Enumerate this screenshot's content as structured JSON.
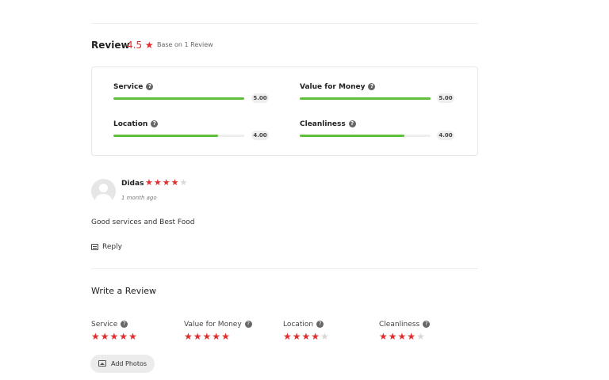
{
  "summary": {
    "title": "Review",
    "rating": "4.5",
    "star_glyph": "★",
    "based_on": "Base on 1 Review"
  },
  "categories": [
    {
      "label": "Service",
      "score": "5.00",
      "fill": 1.0
    },
    {
      "label": "Value for Money",
      "score": "5.00",
      "fill": 1.0
    },
    {
      "label": "Location",
      "score": "4.00",
      "fill": 0.8
    },
    {
      "label": "Cleanliness",
      "score": "4.00",
      "fill": 0.8
    }
  ],
  "review": {
    "author": "Didas",
    "stars": 4,
    "max_stars": 5,
    "time": "1 month ago",
    "text": "Good services and Best Food",
    "reply_label": "Reply"
  },
  "write_review": {
    "title": "Write a Review",
    "fields": [
      {
        "label": "Service",
        "stars": 5
      },
      {
        "label": "Value for Money",
        "stars": 5
      },
      {
        "label": "Location",
        "stars": 4
      },
      {
        "label": "Cleanliness",
        "stars": 4
      }
    ],
    "add_photos_label": "Add Photos"
  },
  "colors": {
    "accent_red": "#e22d2d",
    "bar_green": "#5fbf3b",
    "star_empty": "#d8d8d8"
  },
  "icons": {
    "help": "question-mark-circle-icon",
    "reply": "reply-icon",
    "photo": "photo-icon",
    "avatar": "user-avatar-icon"
  }
}
